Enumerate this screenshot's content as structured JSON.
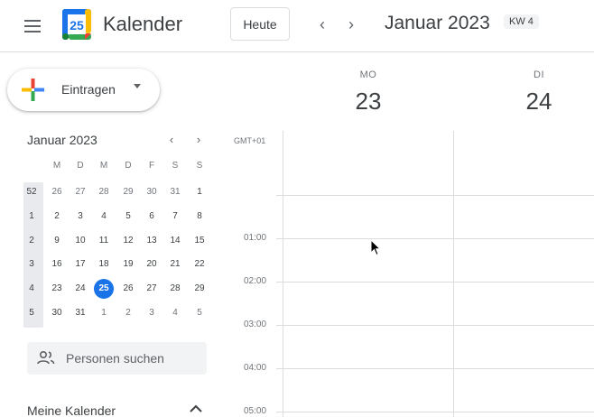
{
  "header": {
    "app_title": "Kalender",
    "logo_day": "25",
    "today_label": "Heute",
    "prev_icon": "chevron-left-icon",
    "next_icon": "chevron-right-icon",
    "prev_symbol": "‹",
    "next_symbol": "›",
    "period": "Januar 2023",
    "week_badge": "KW 4"
  },
  "create": {
    "label": "Eintragen"
  },
  "mini_calendar": {
    "title": "Januar 2023",
    "prev_symbol": "‹",
    "next_symbol": "›",
    "weekday_headers": [
      "M",
      "D",
      "M",
      "D",
      "F",
      "S",
      "S"
    ],
    "weeks": [
      {
        "kw": "52",
        "days": [
          "26",
          "27",
          "28",
          "29",
          "30",
          "31",
          "1"
        ]
      },
      {
        "kw": "1",
        "days": [
          "2",
          "3",
          "4",
          "5",
          "6",
          "7",
          "8"
        ]
      },
      {
        "kw": "2",
        "days": [
          "9",
          "10",
          "11",
          "12",
          "13",
          "14",
          "15"
        ]
      },
      {
        "kw": "3",
        "days": [
          "16",
          "17",
          "18",
          "19",
          "20",
          "21",
          "22"
        ]
      },
      {
        "kw": "4",
        "days": [
          "23",
          "24",
          "25",
          "26",
          "27",
          "28",
          "29"
        ]
      },
      {
        "kw": "5",
        "days": [
          "30",
          "31",
          "1",
          "2",
          "3",
          "4",
          "5"
        ]
      }
    ],
    "today": "25"
  },
  "people_search": {
    "placeholder": "Personen suchen"
  },
  "my_calendars": {
    "label": "Meine Kalender"
  },
  "week_view": {
    "timezone": "GMT+01",
    "days": [
      {
        "name": "MO",
        "number": "23"
      },
      {
        "name": "DI",
        "number": "24"
      }
    ],
    "time_labels": [
      "01:00",
      "02:00",
      "03:00",
      "04:00",
      "05:00"
    ]
  },
  "colors": {
    "accent": "#1a73e8",
    "grid_line": "#dadce0",
    "text": "#3c4043",
    "muted": "#70757a"
  }
}
